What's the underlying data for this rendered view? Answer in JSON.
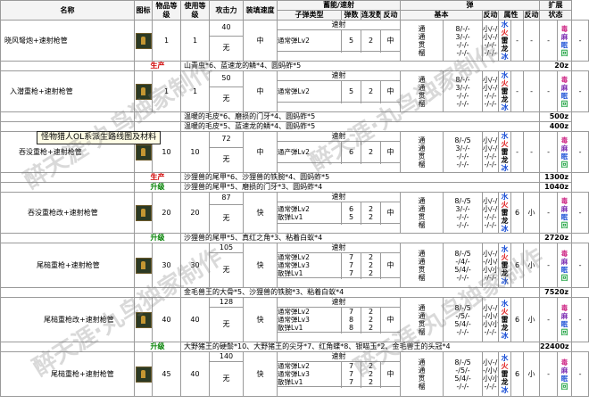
{
  "headers": {
    "name": "名称",
    "icon": "图标",
    "item_level": "物品等级",
    "use_level": "使用等级",
    "attack": "攻击力",
    "reload": "装填速度",
    "charge_group": "蓄能/速射",
    "bullet_type": "子弹类型",
    "bullet_count": "弹数",
    "burst": "连发数",
    "recoil": "反动",
    "ammo_group": "弹",
    "basic": "基本",
    "recoil2": "反动",
    "attribute": "属性",
    "recoil3": "反动",
    "recoil4": "反动",
    "expand": "扩展",
    "state": "状态",
    "recoil5": "反动"
  },
  "tooltip": "怪物猎人OL系派生路线图及材料",
  "watermark": "醉天涯·丸鸟独家制作",
  "attr_labels": [
    "水",
    "火",
    "雷",
    "龙",
    "冰"
  ],
  "ext_labels": [
    "毒",
    "麻",
    "眠",
    "回"
  ],
  "colors": {
    "production": "#d00000",
    "upgrade": "#008000",
    "water": "#1a4fd6",
    "fire": "#e02020"
  },
  "weapons": [
    {
      "name": "晓风弩炮+速射枪管",
      "item_level": "1",
      "use_level": "1",
      "attack": "40",
      "attack2": "无",
      "reload": "中",
      "rapid": "速射",
      "bullets": [
        "通常弹Lv2"
      ],
      "count": [
        "5"
      ],
      "burst": [
        "2"
      ],
      "b_recoil": "中",
      "basic": [
        "通",
        "通",
        "贯",
        "榴"
      ],
      "basic_vals": [
        "8/-/-",
        "3/-/-",
        "-/-/-",
        "-/-/-"
      ],
      "recoil": [
        "小/-/-",
        "小/-/-",
        "-/-/-",
        "-/-/-"
      ],
      "attr_val": "-",
      "side1": "-",
      "side2": "-",
      "ext_val": "-",
      "ext_side": "-",
      "craft": {
        "label": "生产",
        "type": "production",
        "mats": "山青虫*6、蓝速龙的鳞*4、圆蚂蚱*5",
        "price": "20z"
      }
    },
    {
      "name": "入潜重枪+速射枪管",
      "item_level": "1",
      "use_level": "1",
      "attack": "50",
      "attack2": "无",
      "reload": "中",
      "rapid": "速射",
      "bullets": [
        "通常弹Lv2"
      ],
      "count": [
        "5"
      ],
      "burst": [
        "2"
      ],
      "b_recoil": "中",
      "basic": [
        "通",
        "通",
        "贯",
        "榴"
      ],
      "basic_vals": [
        "8/-/-",
        "3/-/-",
        "-/-/-",
        "-/-/-"
      ],
      "recoil": [
        "小/-/-",
        "小/-/-",
        "-/-/-",
        "-/-/-"
      ],
      "attr_val": "-",
      "side1": "-",
      "side2": "-",
      "ext_val": "-",
      "ext_side": "-",
      "craft": [
        {
          "label": "",
          "type": "production",
          "mats": "温暖的毛皮*6、磨损的门牙*4、圆蚂蚱*5",
          "price": "500z"
        },
        {
          "label": "",
          "type": "upgrade",
          "mats": "温暖的毛皮*5、蓝速龙的鳞*4、圆蚂蚱*5",
          "price": "400z"
        }
      ]
    },
    {
      "name": "吞没重枪+速射枪管",
      "item_level": "10",
      "use_level": "10",
      "attack": "72",
      "attack2": "无",
      "reload": "中",
      "rapid": "速射",
      "bullets": [
        "通产弹Lv2"
      ],
      "count": [
        "6"
      ],
      "burst": [
        "2"
      ],
      "b_recoil": "中",
      "basic": [
        "通",
        "通",
        "贯",
        "榴"
      ],
      "basic_vals": [
        "8/-/5",
        "3/-/-",
        "-/-/-",
        "-/-/-"
      ],
      "recoil": [
        "小/-/中",
        "小/-/-",
        "-/-/-",
        "-/-/-"
      ],
      "attr_val": "-",
      "side1": "-",
      "side2": "-",
      "ext_val": "-",
      "ext_side": "-",
      "craft": [
        {
          "label": "生产",
          "type": "production",
          "mats": "沙狸兽的尾甲*6、沙狸兽的铁腕*4、圆蚂蚱*5",
          "price": "1300z"
        },
        {
          "label": "升级",
          "type": "upgrade",
          "mats": "沙狸兽的尾甲*5、磨损的门牙*3、圆蚂蚱*4",
          "price": "1040z"
        }
      ]
    },
    {
      "name": "吞没重枪改+速射枪管",
      "item_level": "20",
      "use_level": "20",
      "attack": "87",
      "attack2": "无",
      "reload": "快",
      "rapid": "速射",
      "bullets": [
        "通常弹Lv2",
        "散弹Lv1"
      ],
      "count": [
        "6",
        "5"
      ],
      "burst": [
        "2",
        "2"
      ],
      "b_recoil": "中",
      "basic": [
        "通",
        "通",
        "贯",
        "榴"
      ],
      "basic_vals": [
        "8/-/5",
        "3/-/-",
        "-/-/-",
        "-/-/-"
      ],
      "recoil": [
        "小/-/中",
        "小/-/-",
        "-/-/-",
        "-/-/-"
      ],
      "attr_val": "6",
      "side1": "小",
      "side2": "-",
      "ext_val": "-",
      "ext_side": "-",
      "craft": {
        "label": "升级",
        "type": "upgrade",
        "mats": "沙狸兽的尾甲*5、真红之角*3、粘着白蚁*4",
        "price": "2720z"
      }
    },
    {
      "name": "尾槌重枪+速射枪管",
      "item_level": "30",
      "use_level": "30",
      "attack": "105",
      "attack2": "无",
      "reload": "快",
      "rapid": "速射",
      "bullets": [
        "通常弹Lv2",
        "通常弹Lv3",
        "散弹Lv1"
      ],
      "count": [
        "7",
        "7",
        "7"
      ],
      "burst": [
        "2",
        "2",
        "2"
      ],
      "b_recoil": "中",
      "basic": [
        "通",
        "通",
        "贯",
        "榴"
      ],
      "basic_vals": [
        "8/-/5",
        "-/4/-",
        "5/4/-",
        "-/-/-"
      ],
      "recoil": [
        "小/-/中",
        "-/小/-",
        "小/小/-",
        "-/-/-"
      ],
      "attr_val": "6",
      "side1": "小",
      "side2": "-",
      "ext_val": "-",
      "ext_side": "-",
      "craft": {
        "label": "",
        "type": "upgrade",
        "mats": "金毛兽王的大骨*5、沙狸兽的铁腕*3、粘着白蚁*4",
        "price": "7520z"
      }
    },
    {
      "name": "尾槌重枪改+速射枪管",
      "item_level": "40",
      "use_level": "40",
      "attack": "128",
      "attack2": "无",
      "reload": "快",
      "rapid": "速射",
      "bullets": [
        "通常弹Lv2",
        "通常弹Lv3",
        "散弹Lv1"
      ],
      "count": [
        "7",
        "8",
        "8"
      ],
      "burst": [
        "2",
        "2",
        "2"
      ],
      "b_recoil": "中",
      "basic": [
        "通",
        "通",
        "贯",
        "榴"
      ],
      "basic_vals": [
        "8/-/5",
        "-/5/-",
        "5/4/-",
        "-/-/-"
      ],
      "recoil": [
        "小/-/中",
        "-/小/-",
        "小/小/-",
        "-/-/-"
      ],
      "attr_val": "6",
      "side1": "小",
      "side2": "-",
      "ext_val": "-",
      "ext_side": "-",
      "craft": {
        "label": "升级",
        "type": "upgrade",
        "mats": "大野猪王的硬鬃*10、大野猪王的尖牙*7、红角蝶*8、银喵玉*2、金毛兽王的头冠*4",
        "price": "22400z"
      }
    },
    {
      "name": "尾槌重枪+速射枪管",
      "item_level": "45",
      "use_level": "40",
      "attack": "140",
      "attack2": "无",
      "reload": "快",
      "rapid": "速射",
      "bullets": [
        "通常弹Lv2",
        "通常弹Lv3",
        "散弹Lv1"
      ],
      "count": [
        "7",
        "7",
        "7"
      ],
      "burst": [
        "2",
        "2",
        "2"
      ],
      "b_recoil": "中",
      "basic": [
        "通",
        "通",
        "贯",
        "榴"
      ],
      "basic_vals": [
        "8/-/5",
        "-/5/-",
        "5/4/-",
        "-/-/-"
      ],
      "recoil": [
        "小/-/中",
        "-/小/-",
        "小/小/-",
        "-/-/-"
      ],
      "attr_val": "6",
      "side1": "小",
      "side2": "-",
      "ext_val": "-",
      "ext_side": "-"
    }
  ]
}
